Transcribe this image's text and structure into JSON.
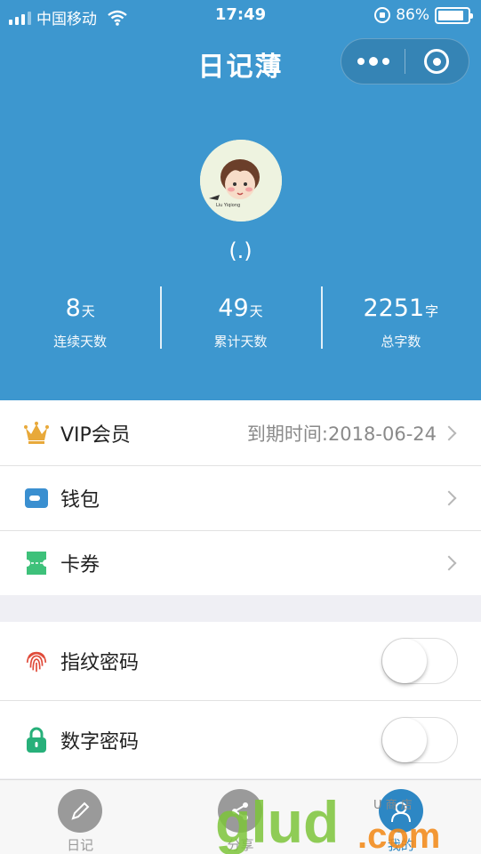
{
  "status_bar": {
    "carrier": "中国移动",
    "time": "17:49",
    "battery_text": "86%",
    "battery_level": 0.86
  },
  "nav": {
    "title": "日记薄"
  },
  "profile": {
    "avatar_caption": "Liu  Yiqiong",
    "nickname": "(.)"
  },
  "stats": [
    {
      "value": "8",
      "unit": "天",
      "label": "连续天数"
    },
    {
      "value": "49",
      "unit": "天",
      "label": "累计天数"
    },
    {
      "value": "2251",
      "unit": "字",
      "label": "总字数"
    }
  ],
  "menu": {
    "vip": {
      "label": "VIP会员",
      "value": "到期时间:2018-06-24",
      "icon": "crown-icon"
    },
    "wallet": {
      "label": "钱包",
      "icon": "wallet-icon"
    },
    "coupons": {
      "label": "卡券",
      "icon": "ticket-icon"
    }
  },
  "security": {
    "fingerprint": {
      "label": "指纹密码",
      "enabled": false,
      "icon": "fingerprint-icon"
    },
    "pin": {
      "label": "数字密码",
      "enabled": false,
      "icon": "lock-icon"
    }
  },
  "tabs": [
    {
      "label": "日记",
      "icon": "pencil-icon",
      "active": false
    },
    {
      "label": "分享",
      "icon": "share-icon",
      "active": false
    },
    {
      "label": "我的",
      "icon": "user-icon",
      "active": true
    }
  ],
  "watermark": {
    "brand": "glud",
    "domain": ".com",
    "small": "U 商 店"
  },
  "colors": {
    "primary": "#3d97cf",
    "tab_active": "#2d87c4",
    "crown": "#e8a93a",
    "wallet": "#3a8fd0",
    "ticket": "#3ec17a",
    "fingerprint": "#e04b3a",
    "lock": "#27b07a"
  }
}
